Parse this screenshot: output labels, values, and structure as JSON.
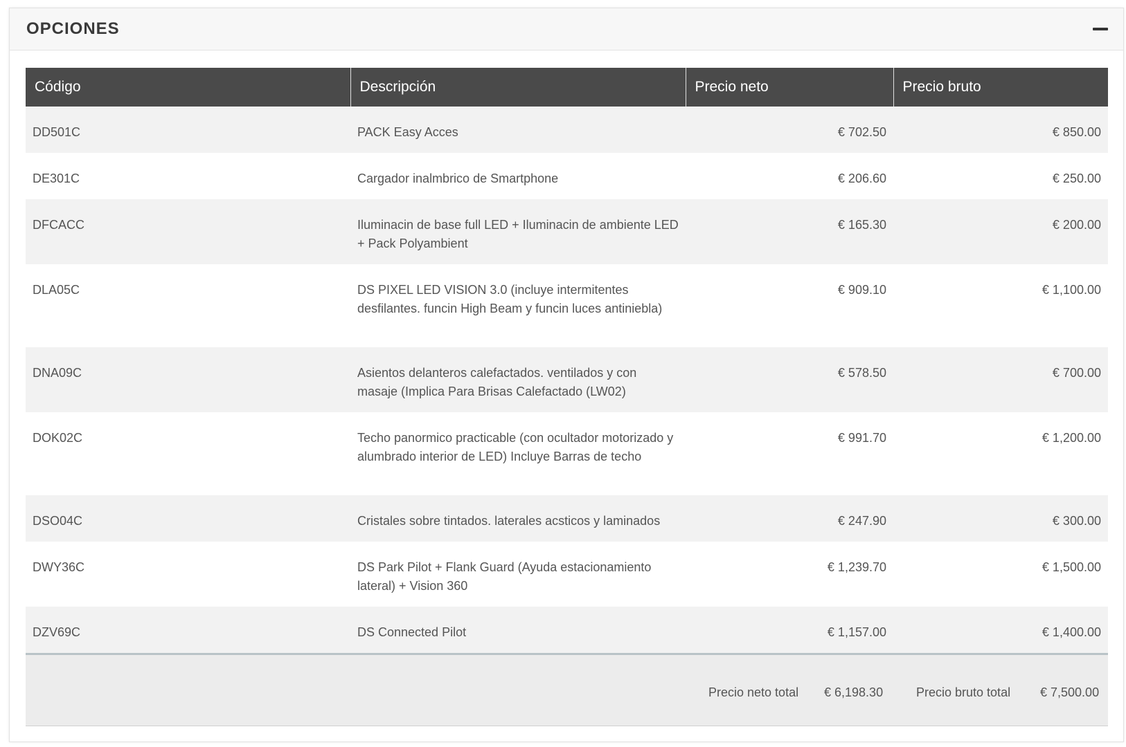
{
  "panel": {
    "title": "OPCIONES"
  },
  "table": {
    "headers": [
      "Código",
      "Descripción",
      "Precio neto",
      "Precio bruto"
    ],
    "rows": [
      {
        "code": "DD501C",
        "description": "PACK Easy Acces",
        "net": "€ 702.50",
        "gross": "€ 850.00"
      },
      {
        "code": "DE301C",
        "description": "Cargador inalmbrico de Smartphone",
        "net": "€ 206.60",
        "gross": "€ 250.00"
      },
      {
        "code": "DFCACC",
        "description": "Iluminacin de base full LED + Iluminacin de ambiente LED + Pack Polyambient",
        "net": "€ 165.30",
        "gross": "€ 200.00"
      },
      {
        "code": "DLA05C",
        "description": "DS PIXEL LED VISION 3.0 (incluye intermitentes desfilantes. funcin High Beam y funcin luces antiniebla)",
        "net": "€ 909.10",
        "gross": "€ 1,100.00"
      },
      {
        "code": "DNA09C",
        "description": "Asientos delanteros calefactados. ventilados y con masaje (Implica Para Brisas Calefactado (LW02)",
        "net": "€ 578.50",
        "gross": "€ 700.00"
      },
      {
        "code": "DOK02C",
        "description": "Techo panormico practicable (con ocultador motorizado y alumbrado interior de LED) Incluye Barras de techo",
        "net": "€ 991.70",
        "gross": "€ 1,200.00"
      },
      {
        "code": "DSO04C",
        "description": "Cristales sobre tintados. laterales acsticos y laminados",
        "net": "€ 247.90",
        "gross": "€ 300.00"
      },
      {
        "code": "DWY36C",
        "description": "DS Park Pilot + Flank Guard (Ayuda estacionamiento lateral) + Vision 360",
        "net": "€ 1,239.70",
        "gross": "€ 1,500.00"
      },
      {
        "code": "DZV69C",
        "description": "DS Connected Pilot",
        "net": "€ 1,157.00",
        "gross": "€ 1,400.00"
      }
    ]
  },
  "totals": {
    "net_label": "Precio neto total",
    "net_value": "€ 6,198.30",
    "gross_label": "Precio bruto total",
    "gross_value": "€ 7,500.00"
  }
}
